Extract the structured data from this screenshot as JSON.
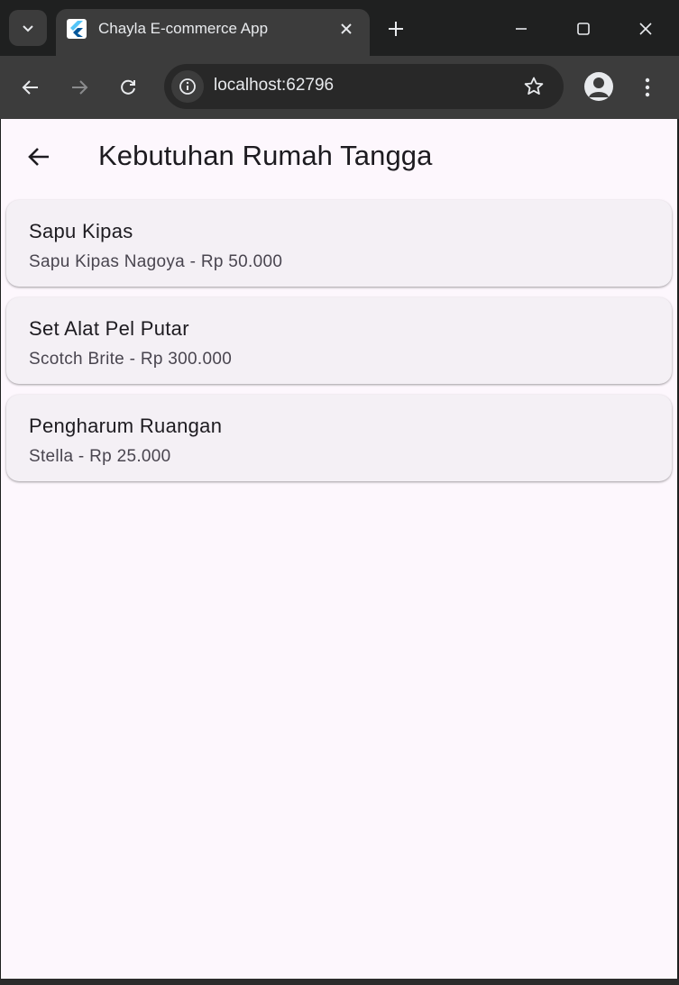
{
  "browser": {
    "tab": {
      "title": "Chayla E-commerce App",
      "favicon": "flutter-icon"
    },
    "address": {
      "url": "localhost:62796"
    },
    "colors": {
      "frame": "#1f2020",
      "toolbar": "#3c3c3c",
      "text": "#e8eaed"
    }
  },
  "app": {
    "title": "Kebutuhan Rumah Tangga",
    "colors": {
      "background": "#fdf7fd",
      "card": "#f4f0f5",
      "title_text": "#1d1b20",
      "subtitle_text": "#49454f"
    },
    "items": [
      {
        "name": "Sapu Kipas",
        "detail": "Sapu Kipas Nagoya - Rp 50.000"
      },
      {
        "name": "Set Alat Pel Putar",
        "detail": "Scotch Brite - Rp 300.000"
      },
      {
        "name": "Pengharum Ruangan",
        "detail": "Stella - Rp 25.000"
      }
    ]
  }
}
